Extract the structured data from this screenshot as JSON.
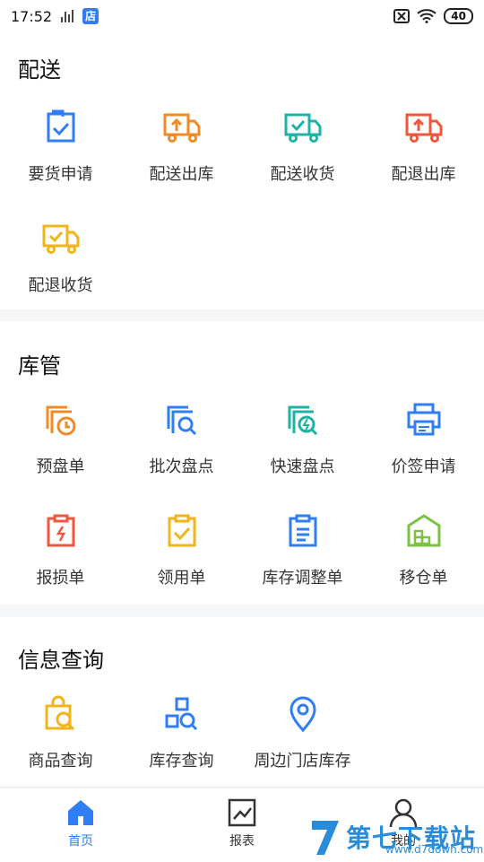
{
  "status_bar": {
    "time": "17:52",
    "store_badge": "店",
    "battery": "40"
  },
  "sections": [
    {
      "title": "配送",
      "items": [
        {
          "label": "要货申请",
          "icon": "clipboard-check-icon",
          "color": "#2f7ef5"
        },
        {
          "label": "配送出库",
          "icon": "truck-upload-icon",
          "color": "#f08a24"
        },
        {
          "label": "配送收货",
          "icon": "truck-check-icon",
          "color": "#1fb3a5"
        },
        {
          "label": "配退出库",
          "icon": "truck-upload-icon",
          "color": "#f0573c"
        },
        {
          "label": "配退收货",
          "icon": "truck-check-icon",
          "color": "#f2b418"
        }
      ]
    },
    {
      "title": "库管",
      "items": [
        {
          "label": "预盘单",
          "icon": "stack-clock-icon",
          "color": "#f08a24"
        },
        {
          "label": "批次盘点",
          "icon": "stack-search-icon",
          "color": "#2f7ef5"
        },
        {
          "label": "快速盘点",
          "icon": "stack-bolt-icon",
          "color": "#1fb3a5"
        },
        {
          "label": "价签申请",
          "icon": "printer-icon",
          "color": "#2f7ef5"
        },
        {
          "label": "报损单",
          "icon": "clipboard-bolt-icon",
          "color": "#f0573c"
        },
        {
          "label": "领用单",
          "icon": "clipboard-check-icon",
          "color": "#f2b418"
        },
        {
          "label": "库存调整单",
          "icon": "clipboard-list-icon",
          "color": "#2f7ef5"
        },
        {
          "label": "移仓单",
          "icon": "warehouse-icon",
          "color": "#7cc142"
        }
      ]
    },
    {
      "title": "信息查询",
      "items": [
        {
          "label": "商品查询",
          "icon": "bag-search-icon",
          "color": "#f2b418"
        },
        {
          "label": "库存查询",
          "icon": "shapes-search-icon",
          "color": "#2f7ef5"
        },
        {
          "label": "周边门店库存",
          "icon": "location-pin-icon",
          "color": "#2f7ef5"
        }
      ]
    }
  ],
  "tabbar": [
    {
      "label": "首页",
      "icon": "home-icon",
      "active": true
    },
    {
      "label": "报表",
      "icon": "chart-icon",
      "active": false
    },
    {
      "label": "我的",
      "icon": "user-icon",
      "active": false
    }
  ],
  "watermark": {
    "text": "第七下载站",
    "sub": "www.d7down.com"
  }
}
